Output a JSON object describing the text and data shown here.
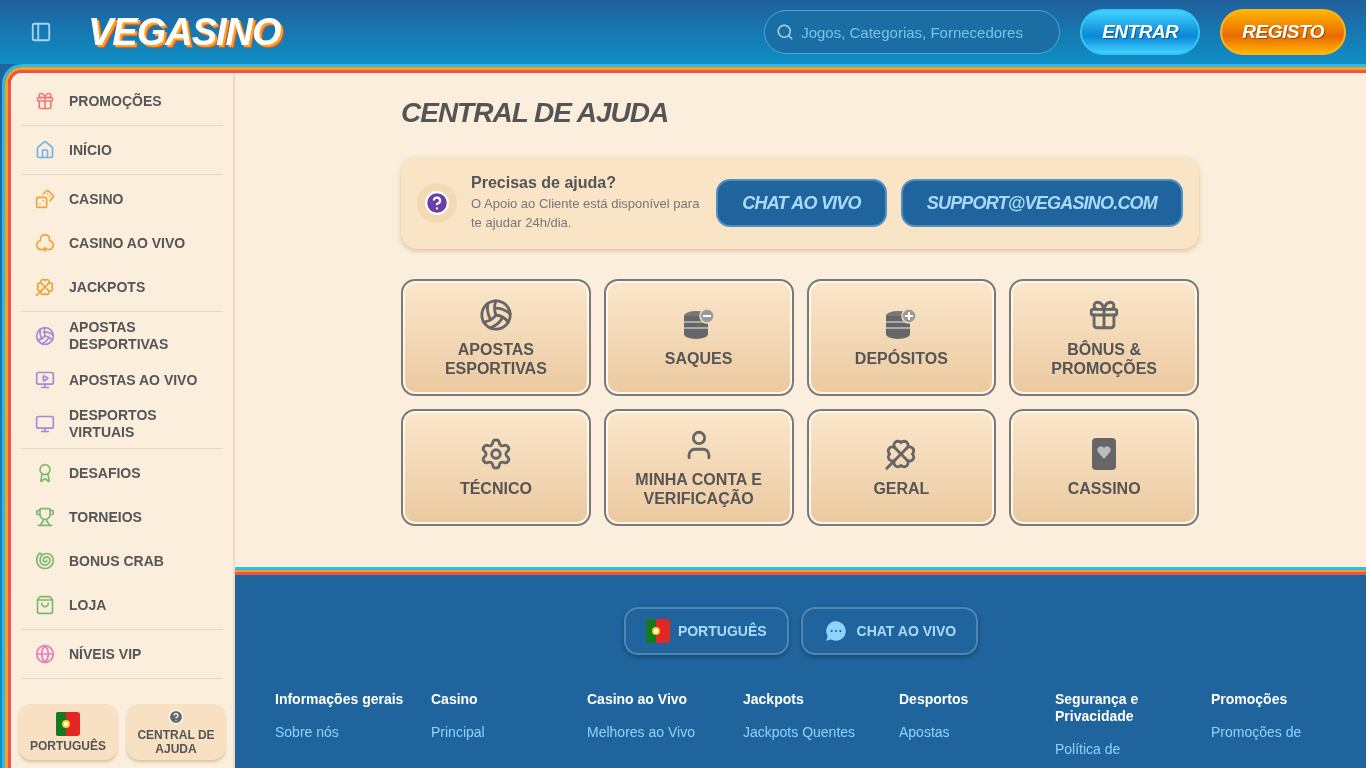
{
  "header": {
    "logo": "VEGASINO",
    "search": {
      "placeholder": "Jogos, Categorias, Fornecedores"
    },
    "buttons": [
      {
        "label": "ENTRAR",
        "kind": "login"
      },
      {
        "label": "REGISTO",
        "kind": "register"
      }
    ]
  },
  "sidebar": {
    "groups": [
      {
        "items": [
          {
            "label": "PROMOÇÕES",
            "color": "#f07b78"
          }
        ]
      },
      {
        "items": [
          {
            "label": "INÍCIO",
            "color": "#6fb3e8"
          }
        ]
      },
      {
        "items": [
          {
            "label": "CASINO",
            "color": "#f0a33c"
          },
          {
            "label": "CASINO AO VIVO",
            "color": "#f0a33c"
          },
          {
            "label": "JACKPOTS",
            "color": "#f0a33c"
          }
        ]
      },
      {
        "items": [
          {
            "label": "APOSTAS DESPORTIVAS",
            "color": "#a58ad8"
          },
          {
            "label": "APOSTAS AO VIVO",
            "color": "#a58ad8"
          },
          {
            "label": "DESPORTOS VIRTUAIS",
            "color": "#a58ad8"
          }
        ]
      },
      {
        "items": [
          {
            "label": "DESAFIOS",
            "color": "#7cba6a"
          },
          {
            "label": "TORNEIOS",
            "color": "#7cba6a"
          },
          {
            "label": "BONUS CRAB",
            "color": "#7cba6a"
          },
          {
            "label": "LOJA",
            "color": "#7cba6a"
          }
        ]
      },
      {
        "items": [
          {
            "label": "NÍVEIS VIP",
            "color": "#e67fb8"
          }
        ]
      }
    ],
    "bottom_buttons": [
      {
        "label": "PORTUGUÊS",
        "kind": "flag"
      },
      {
        "label": "CENTRAL DE AJUDA",
        "kind": "help"
      }
    ]
  },
  "main": {
    "title": "CENTRAL DE AJUDA",
    "help_card": {
      "heading": "Precisas de ajuda?",
      "text": "O Apoio ao Cliente está disponível para te ajudar 24h/dia.",
      "buttons": [
        "CHAT AO VIVO",
        "SUPPORT@VEGASINO.COM"
      ]
    },
    "categories": [
      {
        "label": "APOSTAS ESPORTIVAS",
        "kind": "ball"
      },
      {
        "label": "SAQUES",
        "kind": "withdraw"
      },
      {
        "label": "DEPÓSITOS",
        "kind": "deposit"
      },
      {
        "label": "BÔNUS & PROMOÇÕES",
        "kind": "gift"
      },
      {
        "label": "TÉCNICO",
        "kind": "cog"
      },
      {
        "label": "MINHA CONTA E VERIFICAÇÃO",
        "kind": "user"
      },
      {
        "label": "GERAL",
        "kind": "clover"
      },
      {
        "label": "CASSINO",
        "kind": "card"
      }
    ]
  },
  "footer": {
    "buttons": [
      {
        "label": "PORTUGUÊS",
        "kind": "flag"
      },
      {
        "label": "CHAT AO VIVO",
        "kind": "chat"
      }
    ],
    "columns": [
      {
        "heading": "Informações gerais",
        "links": [
          "Sobre nós"
        ]
      },
      {
        "heading": "Casino",
        "links": [
          "Principal"
        ]
      },
      {
        "heading": "Casino ao Vivo",
        "links": [
          "Melhores ao Vivo"
        ]
      },
      {
        "heading": "Jackpots",
        "links": [
          "Jackpots Quentes"
        ]
      },
      {
        "heading": "Desportos",
        "links": [
          "Apostas"
        ]
      },
      {
        "heading": "Segurança e Privacidade",
        "links": [
          "Política de"
        ]
      },
      {
        "heading": "Promoções",
        "links": [
          "Promoções de"
        ]
      }
    ]
  }
}
